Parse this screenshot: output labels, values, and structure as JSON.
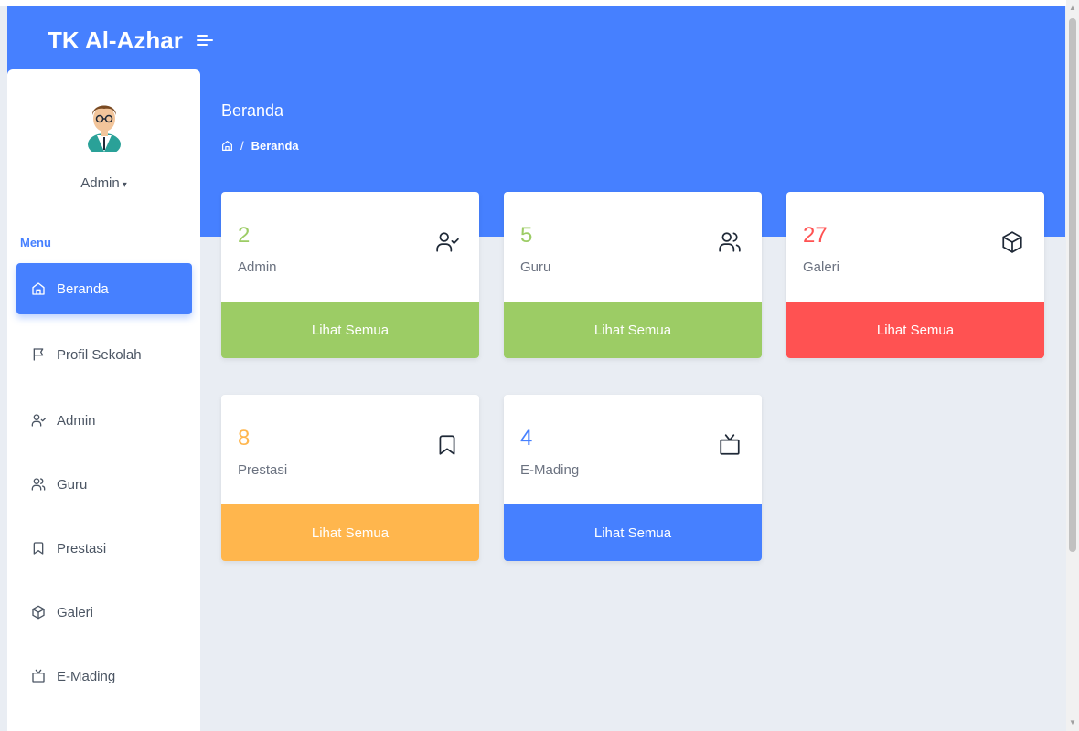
{
  "app": {
    "brand": "TK Al-Azhar"
  },
  "user": {
    "name": "Admin",
    "caret": "▾"
  },
  "sidebar": {
    "caption": "Menu",
    "items": [
      {
        "label": "Beranda",
        "icon": "home-icon",
        "active": true
      },
      {
        "label": "Profil Sekolah",
        "icon": "flag-icon",
        "active": false
      },
      {
        "label": "Admin",
        "icon": "user-check-icon",
        "active": false
      },
      {
        "label": "Guru",
        "icon": "users-icon",
        "active": false
      },
      {
        "label": "Prestasi",
        "icon": "bookmark-icon",
        "active": false
      },
      {
        "label": "Galeri",
        "icon": "box-icon",
        "active": false
      },
      {
        "label": "E-Mading",
        "icon": "tv-icon",
        "active": false
      }
    ]
  },
  "page": {
    "title": "Beranda",
    "breadcrumb": {
      "separator": "/",
      "current": "Beranda"
    }
  },
  "cards": [
    {
      "count": "2",
      "label": "Admin",
      "link": "Lihat Semua",
      "icon": "user-check-icon",
      "color": "#9ccc65"
    },
    {
      "count": "5",
      "label": "Guru",
      "link": "Lihat Semua",
      "icon": "users-icon",
      "color": "#9ccc65"
    },
    {
      "count": "27",
      "label": "Galeri",
      "link": "Lihat Semua",
      "icon": "box-icon",
      "color": "#ff5252"
    },
    {
      "count": "8",
      "label": "Prestasi",
      "link": "Lihat Semua",
      "icon": "bookmark-icon",
      "color": "#ffb64d"
    },
    {
      "count": "4",
      "label": "E-Mading",
      "link": "Lihat Semua",
      "icon": "tv-icon",
      "color": "#4680ff"
    }
  ],
  "colors": {
    "primary": "#4680ff",
    "background": "#e9edf3",
    "text": "#4b5563"
  }
}
